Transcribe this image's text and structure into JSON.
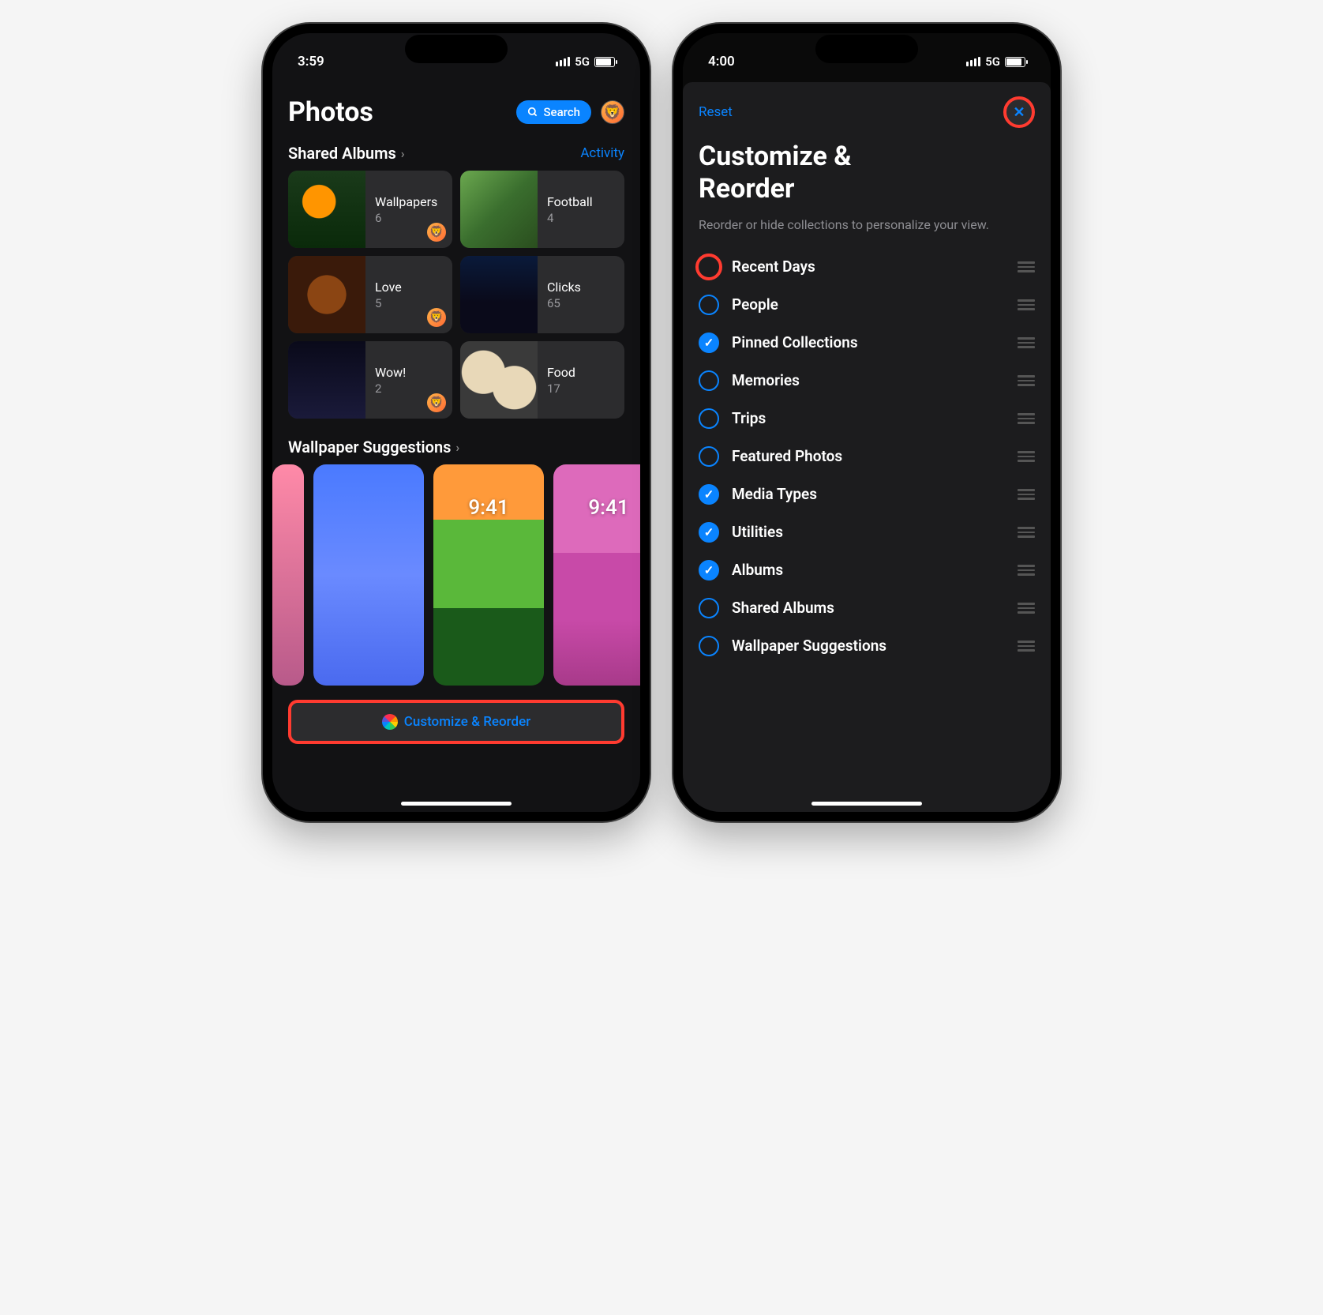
{
  "phone1": {
    "status": {
      "time": "3:59",
      "network": "5G"
    },
    "title": "Photos",
    "search_label": "Search",
    "shared_albums_title": "Shared Albums",
    "activity_label": "Activity",
    "albums": [
      {
        "name": "Wallpapers",
        "count": "6"
      },
      {
        "name": "Football",
        "count": "4"
      },
      {
        "name": "Love",
        "count": "5"
      },
      {
        "name": "Clicks",
        "count": "65"
      },
      {
        "name": "Wow!",
        "count": "2"
      },
      {
        "name": "Food",
        "count": "17"
      }
    ],
    "wallpaper_section_title": "Wallpaper Suggestions",
    "wp_time": "9:41",
    "customize_label": "Customize & Reorder"
  },
  "phone2": {
    "status": {
      "time": "4:00",
      "network": "5G"
    },
    "reset_label": "Reset",
    "title_line1": "Customize &",
    "title_line2": "Reorder",
    "subtitle": "Reorder or hide collections to personalize your view.",
    "items": [
      {
        "label": "Recent Days",
        "checked": false,
        "highlight": true
      },
      {
        "label": "People",
        "checked": false
      },
      {
        "label": "Pinned Collections",
        "checked": true
      },
      {
        "label": "Memories",
        "checked": false
      },
      {
        "label": "Trips",
        "checked": false
      },
      {
        "label": "Featured Photos",
        "checked": false
      },
      {
        "label": "Media Types",
        "checked": true
      },
      {
        "label": "Utilities",
        "checked": true
      },
      {
        "label": "Albums",
        "checked": true
      },
      {
        "label": "Shared Albums",
        "checked": false
      },
      {
        "label": "Wallpaper Suggestions",
        "checked": false
      }
    ]
  }
}
